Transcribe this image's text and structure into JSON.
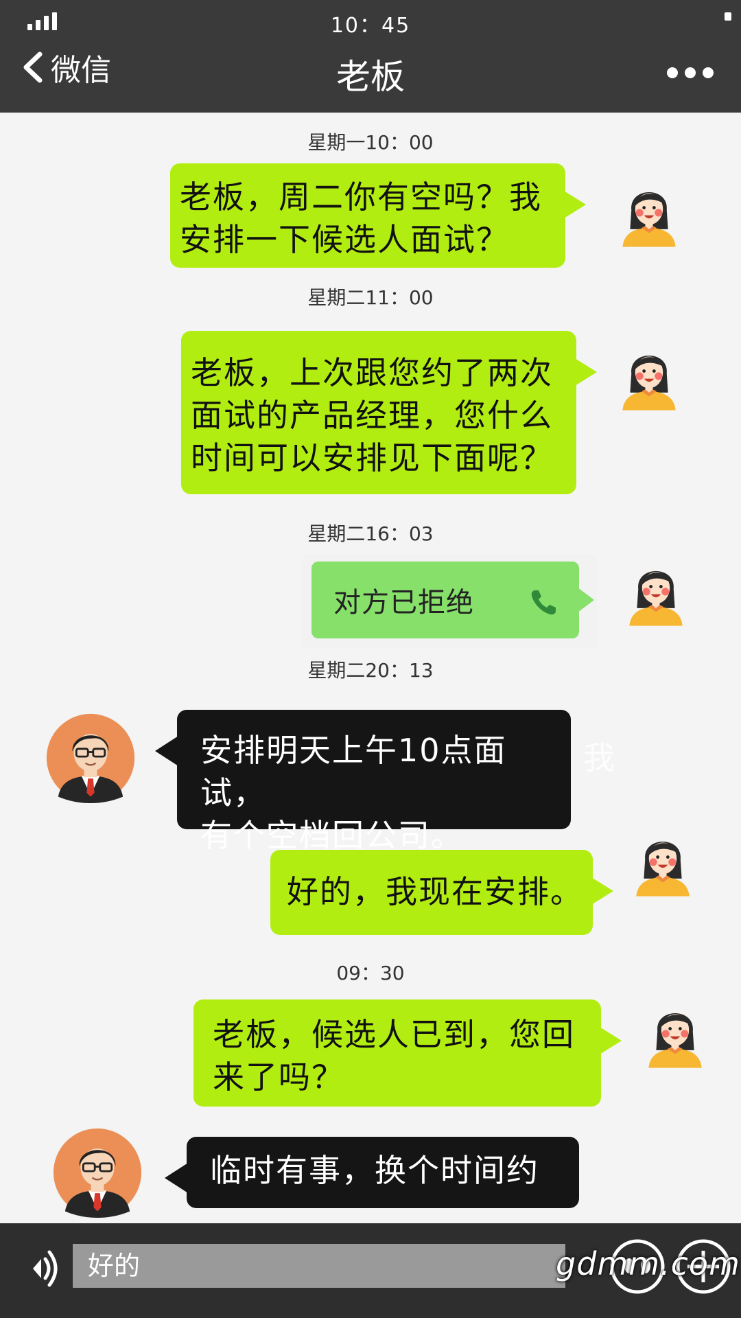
{
  "status_bar": {
    "time": "10：45"
  },
  "header": {
    "back_label": "微信",
    "title": "老板"
  },
  "messages": [
    {
      "timestamp": "星期一10：00",
      "lines": [
        "老板，周二你有空吗？我",
        "安排一下候选人面试？"
      ]
    },
    {
      "timestamp": "星期二11：00",
      "lines": [
        "老板，上次跟您约了两次",
        "面试的产品经理，您什么",
        "时间可以安排见下面呢？"
      ]
    },
    {
      "timestamp": "星期二16：03",
      "call_text": "对方已拒绝"
    },
    {
      "timestamp": "星期二20：13",
      "lines": [
        "安排明天上午10点面试，",
        "有个空档回公司。"
      ],
      "overflow_text": "我"
    },
    {
      "lines": [
        "好的，我现在安排。"
      ]
    },
    {
      "timestamp": "09：30",
      "lines": [
        "老板，候选人已到，您回",
        "来了吗？"
      ]
    },
    {
      "lines": [
        "临时有事，换个时间约"
      ]
    }
  ],
  "input": {
    "value": "好的"
  },
  "watermark": "gdmm.com",
  "colors": {
    "header_bg": "#3a3a3a",
    "outgoing_bubble": "#b2ed11",
    "incoming_bubble": "#151515",
    "call_bubble": "#86e06a"
  },
  "icons": [
    "signal-icon",
    "back-chevron-icon",
    "more-dots-icon",
    "voice-icon",
    "phone-icon",
    "emoji-icon",
    "plus-icon"
  ]
}
